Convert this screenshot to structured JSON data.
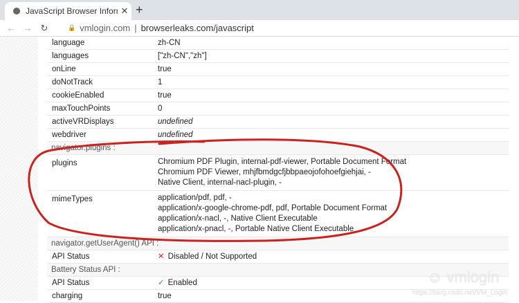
{
  "browser": {
    "tab_title": "JavaScript Browser Information",
    "host": "vmlogin.com",
    "url": "browserleaks.com/javascript"
  },
  "rows_top": [
    {
      "k": "language",
      "v": "zh-CN"
    },
    {
      "k": "languages",
      "v": "[\"zh-CN\",\"zh\"]"
    },
    {
      "k": "onLine",
      "v": "true"
    },
    {
      "k": "doNotTrack",
      "v": "1"
    },
    {
      "k": "cookieEnabled",
      "v": "true"
    },
    {
      "k": "maxTouchPoints",
      "v": "0"
    },
    {
      "k": "activeVRDisplays",
      "v": "undefined"
    },
    {
      "k": "webdriver",
      "v": "undefined"
    }
  ],
  "plugins_section": {
    "title": "navigator.plugins :",
    "plugins": {
      "k": "plugins",
      "lines": [
        "Chromium PDF Plugin, internal-pdf-viewer, Portable Document Format",
        "Chromium PDF Viewer, mhjfbmdgcfjbbpaeojofohoefgiehjai, -",
        "Native Client, internal-nacl-plugin, -"
      ]
    },
    "mimeTypes": {
      "k": "mimeTypes",
      "lines": [
        "application/pdf, pdf, -",
        "application/x-google-chrome-pdf, pdf, Portable Document Format",
        "application/x-nacl, -, Native Client Executable",
        "application/x-pnacl, -, Portable Native Client Executable"
      ]
    }
  },
  "useragent_section": {
    "title": "navigator.getUserAgent() API :",
    "k": "API Status",
    "icon": "✕",
    "v": "Disabled / Not Supported"
  },
  "battery_section": {
    "title": "Battery Status API :",
    "k": "API Status",
    "icon": "✓",
    "v": "Enabled",
    "charging_k": "charging",
    "charging_v": "true"
  },
  "watermark": {
    "brand": "vmlogin",
    "url": "https://blog.csdn.net/VM_Login"
  }
}
